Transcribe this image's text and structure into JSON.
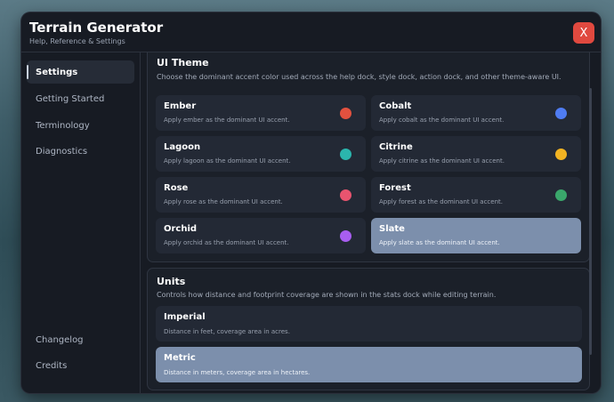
{
  "window": {
    "title": "Terrain Generator",
    "subtitle": "Help, Reference & Settings",
    "close_label": "X"
  },
  "sidebar": {
    "items": [
      {
        "label": "Settings",
        "active": true
      },
      {
        "label": "Getting Started"
      },
      {
        "label": "Terminology"
      },
      {
        "label": "Diagnostics"
      }
    ],
    "bottom_items": [
      {
        "label": "Changelog"
      },
      {
        "label": "Credits"
      }
    ]
  },
  "ui_theme": {
    "title": "UI Theme",
    "description": "Choose the dominant accent color used across the help dock, style dock, action dock, and other theme-aware UI.",
    "options": [
      {
        "name": "Ember",
        "desc": "Apply ember as the dominant UI accent.",
        "color": "#e2513f"
      },
      {
        "name": "Cobalt",
        "desc": "Apply cobalt as the dominant UI accent.",
        "color": "#4f7cf2"
      },
      {
        "name": "Lagoon",
        "desc": "Apply lagoon as the dominant UI accent.",
        "color": "#2bb5ad"
      },
      {
        "name": "Citrine",
        "desc": "Apply citrine as the dominant UI accent.",
        "color": "#f2b322"
      },
      {
        "name": "Rose",
        "desc": "Apply rose as the dominant UI accent.",
        "color": "#e8546f"
      },
      {
        "name": "Forest",
        "desc": "Apply forest as the dominant UI accent.",
        "color": "#3aa76b"
      },
      {
        "name": "Orchid",
        "desc": "Apply orchid as the dominant UI accent.",
        "color": "#a85ef0"
      },
      {
        "name": "Slate",
        "desc": "Apply slate as the dominant UI accent.",
        "color": null,
        "selected": true
      }
    ]
  },
  "units": {
    "title": "Units",
    "description": "Controls how distance and footprint coverage are shown in the stats dock while editing terrain.",
    "options": [
      {
        "name": "Imperial",
        "desc": "Distance in feet, coverage area in acres."
      },
      {
        "name": "Metric",
        "desc": "Distance in meters, coverage area in hectares.",
        "selected": true
      }
    ]
  }
}
